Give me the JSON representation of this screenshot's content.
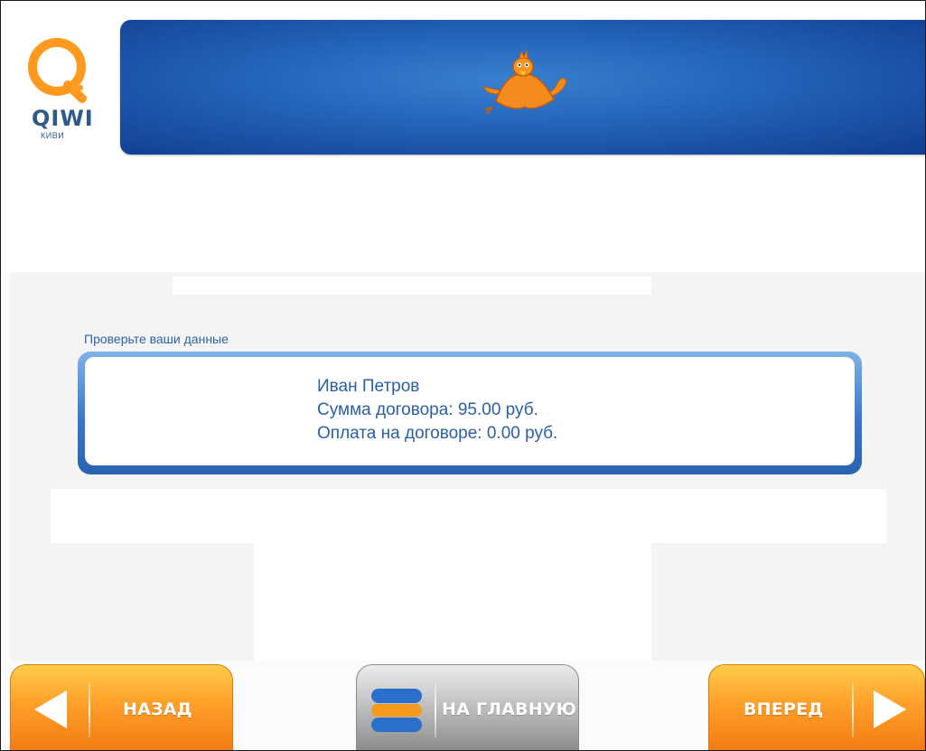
{
  "logo": {
    "brand": "QIWI",
    "sub": "КИВИ"
  },
  "section": {
    "label": "Проверьте ваши данные",
    "lines": [
      "Иван Петров",
      "Сумма договора: 95.00 руб.",
      "Оплата на договоре: 0.00 руб."
    ]
  },
  "nav": {
    "back_label": "НАЗАД",
    "home_label": "НА ГЛАВНУЮ",
    "forward_label": "ВПЕРЕД"
  },
  "colors": {
    "brand_orange": "#ff9a1f",
    "brand_blue": "#2466bb",
    "text_blue": "#2a5fa6"
  },
  "icons": {
    "back": "arrow-left-icon",
    "forward": "arrow-right-icon",
    "home": "qiwi-stack-icon",
    "mascot": "bird-mascot-icon"
  }
}
